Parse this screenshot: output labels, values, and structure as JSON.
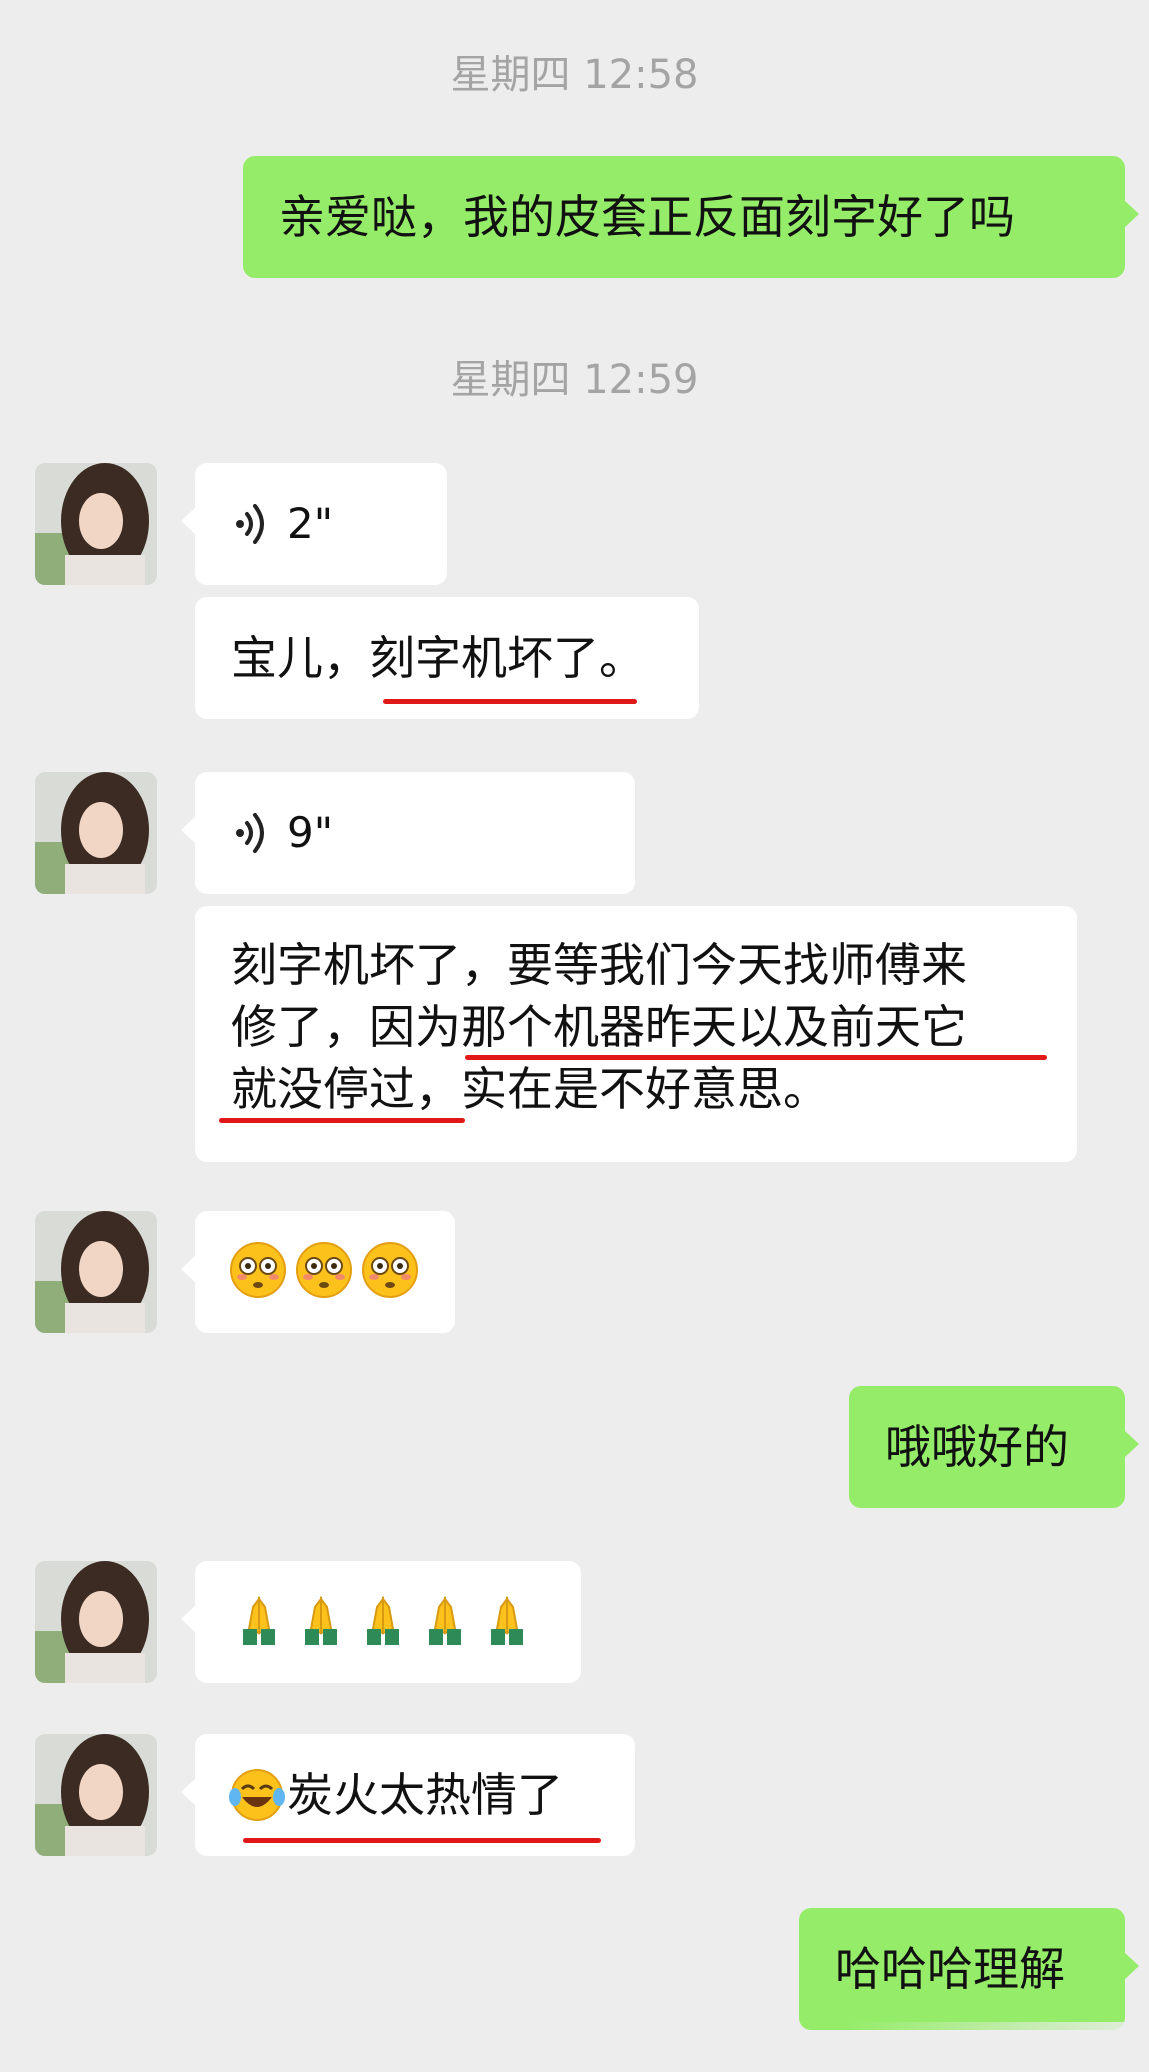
{
  "chat": {
    "timestamp_1": "星期四 12:58",
    "timestamp_2": "星期四 12:59",
    "messages": [
      {
        "from": "me",
        "text": "亲爱哒，我的皮套正反面刻字好了吗"
      },
      {
        "from": "them",
        "type": "voice",
        "duration": "2\""
      },
      {
        "from": "them",
        "text": "宝儿，刻字机坏了。"
      },
      {
        "from": "them",
        "type": "voice",
        "duration": "9\""
      },
      {
        "from": "them",
        "lines": [
          "刻字机坏了，要等我们今天找师傅来",
          "修了，因为那个机器昨天以及前天它",
          "就没停过，实在是不好意思。"
        ]
      },
      {
        "from": "them",
        "type": "emoji",
        "emoji": "flushed-face",
        "count": 3
      },
      {
        "from": "me",
        "text": "哦哦好的"
      },
      {
        "from": "them",
        "type": "emoji",
        "emoji": "folded-hands",
        "count": 5
      },
      {
        "from": "them",
        "emoji": "tears-of-joy",
        "text": "炭火太热情了"
      },
      {
        "from": "me",
        "text": "哈哈哈理解"
      }
    ]
  },
  "colors": {
    "background": "#ededed",
    "outgoing_bubble": "#95ec69",
    "incoming_bubble": "#ffffff",
    "underline": "#e01818"
  }
}
